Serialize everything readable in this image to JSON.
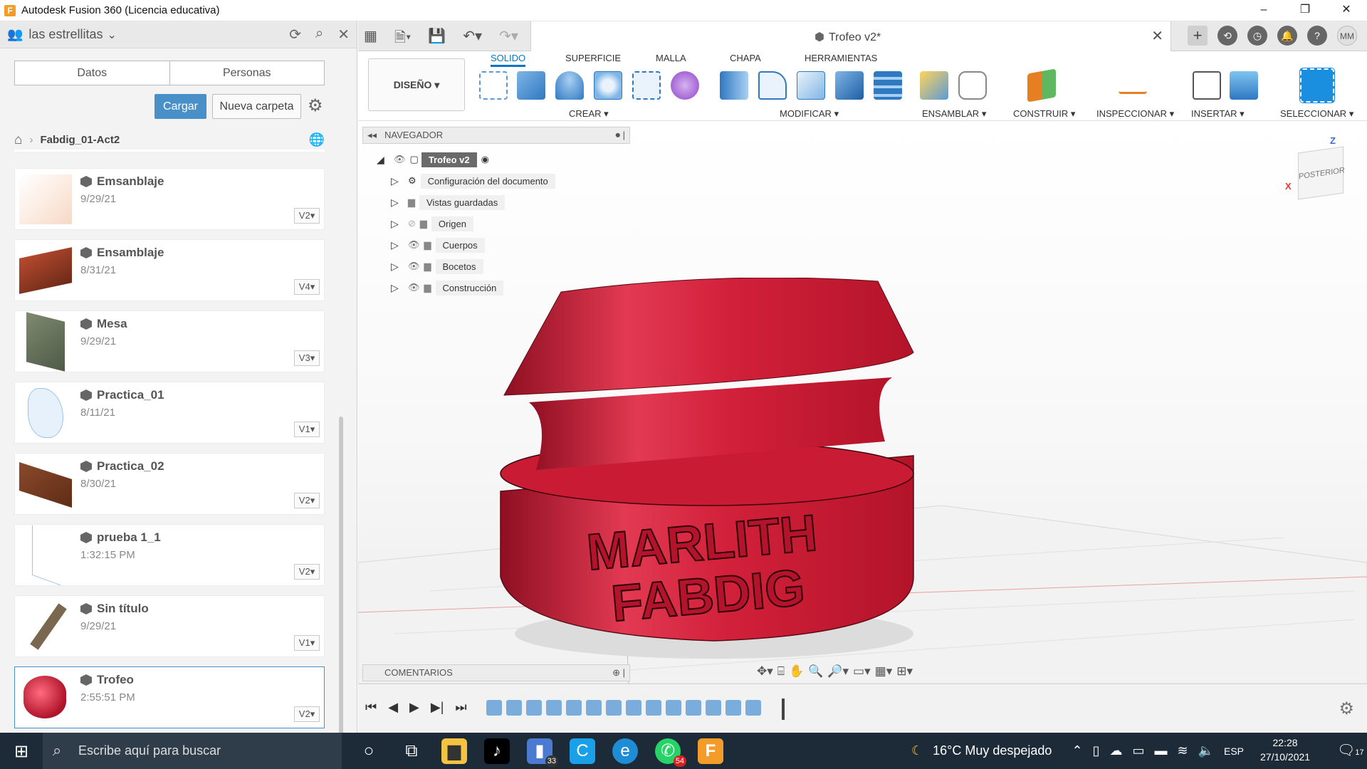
{
  "window": {
    "title": "Autodesk Fusion 360 (Licencia educativa)"
  },
  "left_panel": {
    "team": "las estrellitas",
    "tabs": [
      "Datos",
      "Personas"
    ],
    "upload": "Cargar",
    "new_folder": "Nueva carpeta",
    "breadcrumb": "Fabdig_01-Act2",
    "files": [
      {
        "name": "Emsanblaje",
        "date": "9/29/21",
        "version": "V2"
      },
      {
        "name": "Ensamblaje",
        "date": "8/31/21",
        "version": "V4"
      },
      {
        "name": "Mesa",
        "date": "9/29/21",
        "version": "V3"
      },
      {
        "name": "Practica_01",
        "date": "8/11/21",
        "version": "V1"
      },
      {
        "name": "Practica_02",
        "date": "8/30/21",
        "version": "V2"
      },
      {
        "name": "prueba 1_1",
        "date": "1:32:15 PM",
        "version": "V2"
      },
      {
        "name": "Sin título",
        "date": "9/29/21",
        "version": "V1"
      },
      {
        "name": "Trofeo",
        "date": "2:55:51 PM",
        "version": "V2"
      }
    ]
  },
  "doc_tab": {
    "title": "Trofeo v2*"
  },
  "toolbar": {
    "workspace": "DISEÑO",
    "tabs": [
      "SOLIDO",
      "SUPERFICIE",
      "MALLA",
      "CHAPA",
      "HERRAMIENTAS"
    ],
    "groups": [
      "CREAR",
      "MODIFICAR",
      "ENSAMBLAR",
      "CONSTRUIR",
      "INSPECCIONAR",
      "INSERTAR",
      "SELECCIONAR"
    ]
  },
  "browser": {
    "header": "NAVEGADOR",
    "root": "Trofeo v2",
    "nodes": [
      "Configuración del documento",
      "Vistas guardadas",
      "Origen",
      "Cuerpos",
      "Bocetos",
      "Construcción"
    ]
  },
  "comments": {
    "header": "COMENTARIOS"
  },
  "viewcube": {
    "face": "POSTERIOR",
    "z": "Z",
    "x": "X"
  },
  "model": {
    "line1": "MARLITH",
    "line2": "FABDIG",
    "color": "#d2203a"
  },
  "taskbar": {
    "search_placeholder": "Escribe aquí para buscar",
    "weather": "16°C  Muy despejado",
    "lang": "ESP",
    "time": "22:28",
    "date": "27/10/2021",
    "badge_teams": "33",
    "badge_whatsapp": "54",
    "notif": "17"
  }
}
